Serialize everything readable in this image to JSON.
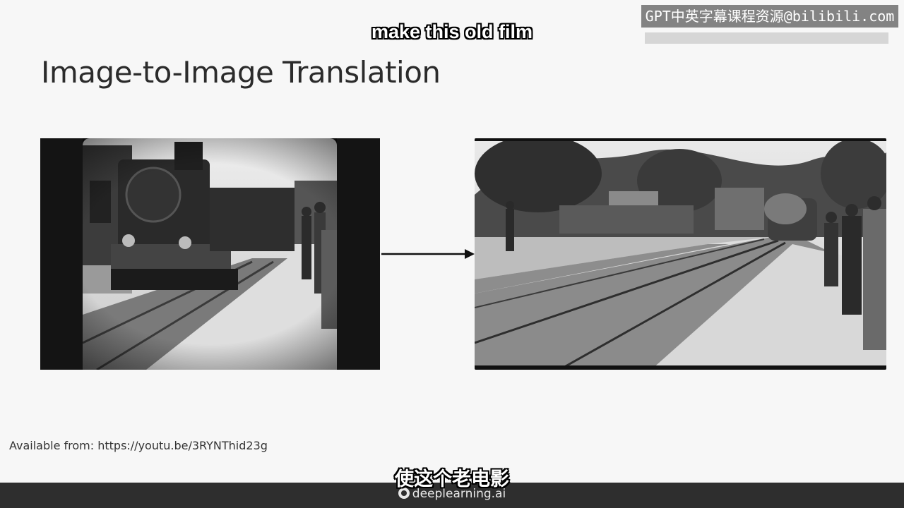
{
  "slide": {
    "title": "Image-to-Image Translation",
    "caption": "Available from: https://youtu.be/3RYNThid23g"
  },
  "subtitles": {
    "english": "make this old film",
    "chinese": "使这个老电影"
  },
  "watermark": {
    "text": "GPT中英字幕课程资源@bilibili.com"
  },
  "footer": {
    "brand": "deeplearning.ai"
  },
  "images": {
    "left": "black-and-white-train-film-frame",
    "right": "enhanced-train-film-frame"
  },
  "colors": {
    "slide_bg": "#f7f7f7",
    "footer_bg": "#2e2e2e",
    "watermark_bg": "#6e6e6e"
  }
}
